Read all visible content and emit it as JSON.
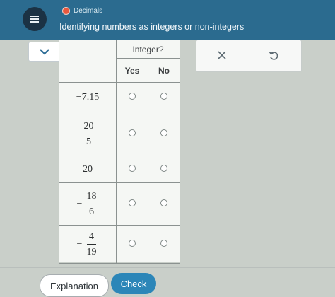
{
  "header": {
    "topic": "Decimals",
    "subtitle": "Identifying numbers as integers or non-integers",
    "menu_icon": "menu-icon"
  },
  "table": {
    "group_header": "Integer?",
    "yes_header": "Yes",
    "no_header": "No",
    "rows": [
      {
        "type": "plain",
        "value": "−7.15"
      },
      {
        "type": "fraction",
        "sign": "",
        "num": "20",
        "den": "5"
      },
      {
        "type": "plain",
        "value": "20"
      },
      {
        "type": "fraction",
        "sign": "−",
        "num": "18",
        "den": "6"
      },
      {
        "type": "fraction",
        "sign": "−",
        "num": "4",
        "den": "19"
      }
    ]
  },
  "panel": {
    "clear_icon": "x-icon",
    "undo_icon": "undo-icon"
  },
  "buttons": {
    "explanation": "Explanation",
    "check": "Check"
  },
  "colors": {
    "header_bg": "#2b6b8f",
    "check_bg": "#2c86b8",
    "topic_dot": "#e9583e"
  }
}
